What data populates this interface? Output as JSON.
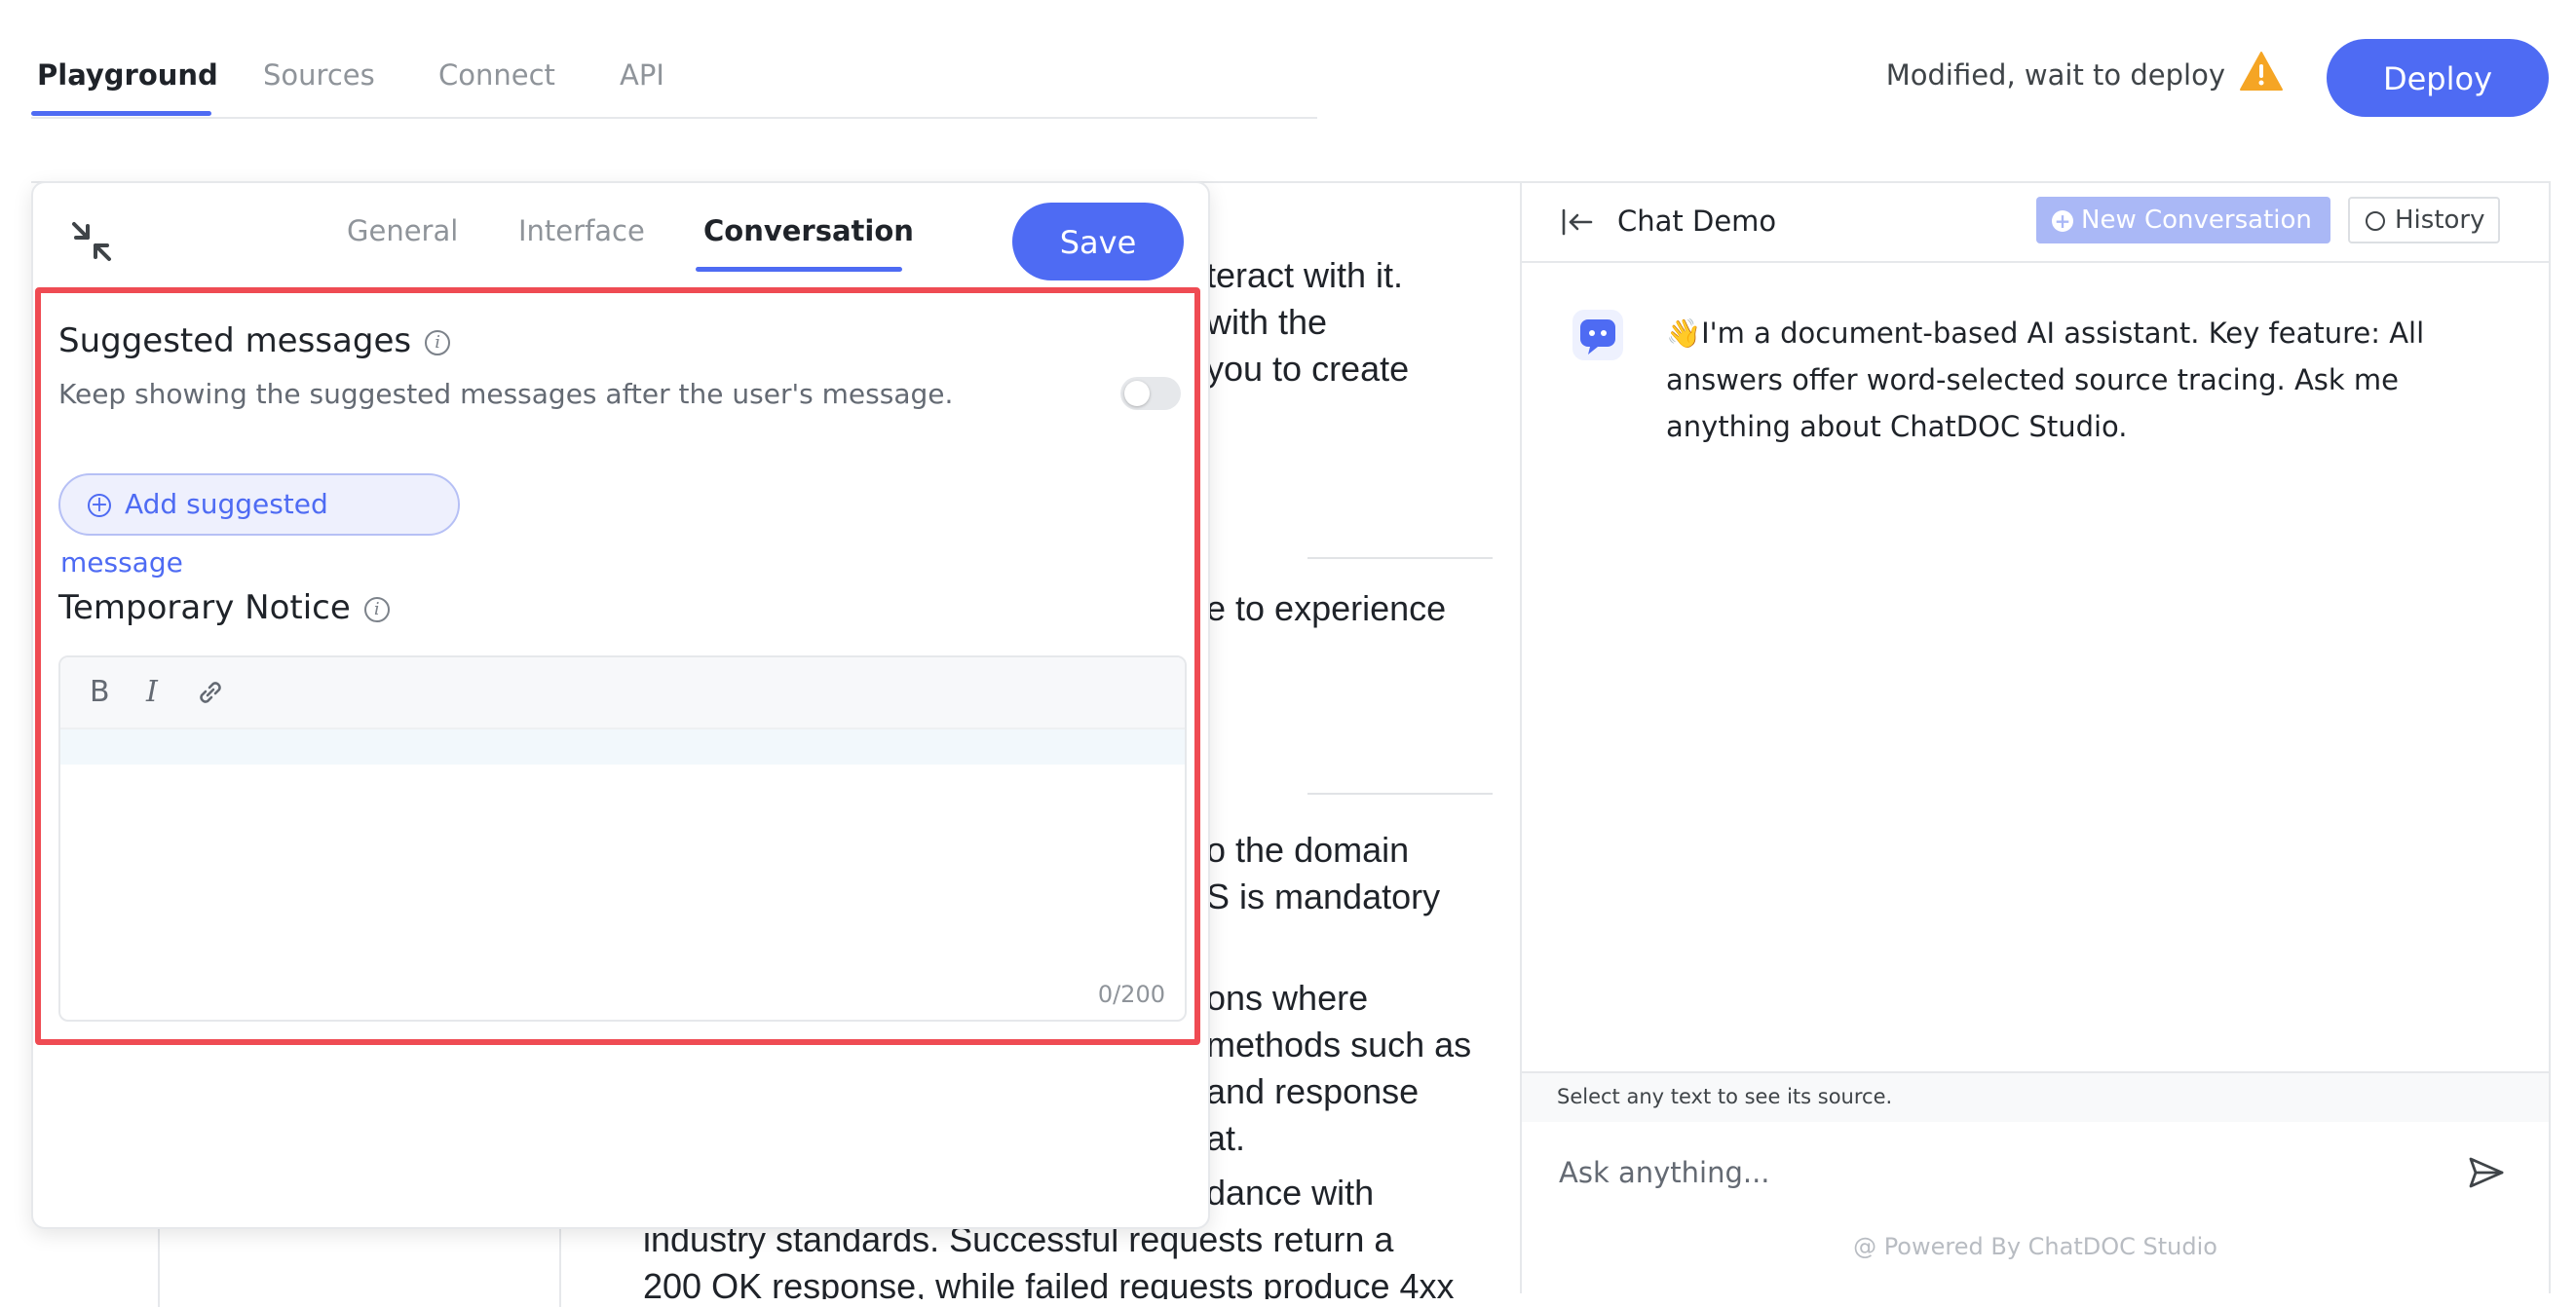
{
  "nav": {
    "tabs": [
      {
        "label": "Playground"
      },
      {
        "label": "Sources"
      },
      {
        "label": "Connect"
      },
      {
        "label": "API"
      }
    ],
    "status_text": "Modified, wait to deploy",
    "deploy_label": "Deploy"
  },
  "doc": {
    "lines": [
      "teract with it.",
      "with the",
      "you to create",
      "e to experience",
      "o the domain",
      "S is mandatory",
      "ons where",
      "methods such as",
      "and response",
      "at.",
      "dance with",
      "industry standards. Successful requests return a",
      "200 OK response, while failed requests produce 4xx"
    ]
  },
  "settings": {
    "tabs": [
      {
        "label": "General"
      },
      {
        "label": "Interface"
      },
      {
        "label": "Conversation"
      }
    ],
    "save_label": "Save",
    "suggested": {
      "title": "Suggested messages",
      "description": "Keep showing the suggested messages after the user's message.",
      "toggle_on": false,
      "add_label": "Add suggested message"
    },
    "notice": {
      "title": "Temporary Notice",
      "counter": "0/200",
      "tools": [
        "B",
        "I"
      ]
    }
  },
  "chat": {
    "title": "Chat Demo",
    "new_conversation_label": "New Conversation",
    "history_label": "History",
    "message": "👋I'm a document-based AI assistant. Key feature: All answers offer word-selected source tracing. Ask me anything about ChatDOC Studio.",
    "hint": "Select any text to see its source.",
    "input_placeholder": "Ask anything...",
    "powered_by": "@ Powered By ChatDOC Studio"
  },
  "colors": {
    "accent": "#4e6bf3",
    "highlight_border": "#ef4b53",
    "warning": "#f5a524"
  }
}
